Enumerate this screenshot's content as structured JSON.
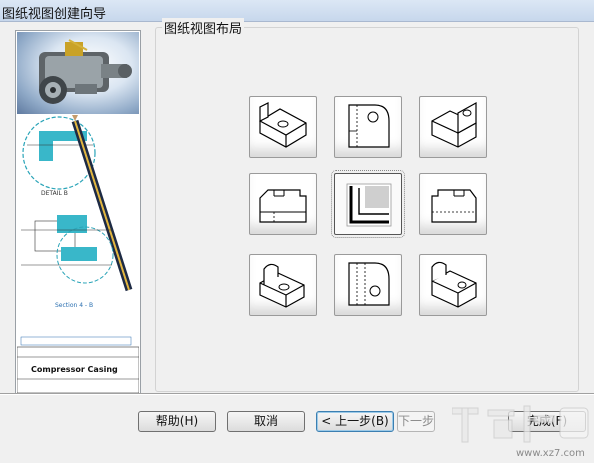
{
  "window": {
    "title": "图纸视图创建向导"
  },
  "side_panel": {
    "detail_label": "DETAIL B",
    "section_label": "Section 4 - B",
    "title_block_text": "Compressor Casing"
  },
  "layout_group": {
    "label": "图纸视图布局",
    "tiles": [
      {
        "name": "tile-iso-top-left",
        "selected": false
      },
      {
        "name": "tile-side-left",
        "selected": false
      },
      {
        "name": "tile-iso-right",
        "selected": false
      },
      {
        "name": "tile-front-left",
        "selected": false
      },
      {
        "name": "tile-center-section",
        "selected": true
      },
      {
        "name": "tile-front-right",
        "selected": false
      },
      {
        "name": "tile-iso-bottom-left",
        "selected": false
      },
      {
        "name": "tile-side-bottom",
        "selected": false
      },
      {
        "name": "tile-iso-bottom-right",
        "selected": false
      }
    ]
  },
  "buttons": {
    "help": "帮助(H)",
    "cancel": "取消",
    "back": "< 上一步(B)",
    "next": "下一步",
    "finish": "完成(F)"
  },
  "watermark": {
    "text": "www.xz7.com"
  }
}
